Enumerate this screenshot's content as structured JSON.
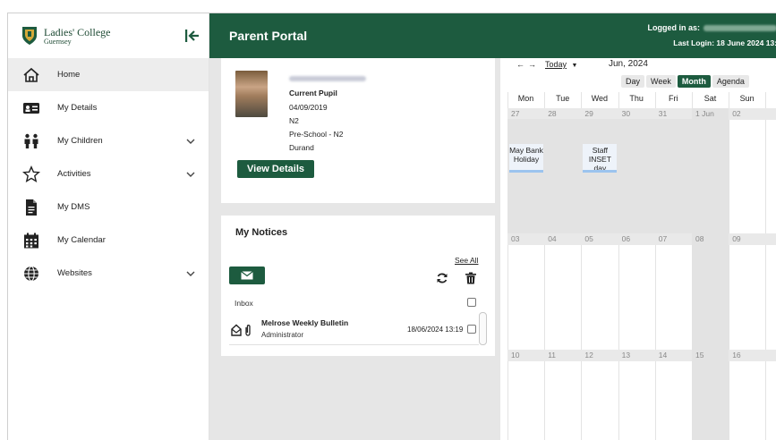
{
  "sidebar": {
    "logo": {
      "line1": "Ladies' College",
      "line2": "Guernsey"
    },
    "items": [
      {
        "label": "Home",
        "icon": "home-icon",
        "active": true
      },
      {
        "label": "My Details",
        "icon": "id-card-icon"
      },
      {
        "label": "My Children",
        "icon": "people-icon",
        "expandable": true
      },
      {
        "label": "Activities",
        "icon": "star-icon",
        "expandable": true
      },
      {
        "label": "My DMS",
        "icon": "document-icon"
      },
      {
        "label": "My Calendar",
        "icon": "calendar-icon"
      },
      {
        "label": "Websites",
        "icon": "globe-icon",
        "expandable": true
      }
    ]
  },
  "header": {
    "title": "Parent Portal",
    "logged_in_label": "Logged in as:",
    "last_login": "Last Login: 18 June 2024 13:"
  },
  "pupil": {
    "status": "Current Pupil",
    "dob": "04/09/2019",
    "year": "N2",
    "class": "Pre-School - N2",
    "house": "Durand",
    "view_button": "View Details"
  },
  "notices": {
    "title": "My Notices",
    "see_all": "See All",
    "folder": "Inbox",
    "messages": [
      {
        "title": "Melrose Weekly Bulletin",
        "from": "Administrator",
        "date": "18/06/2024 13:19"
      }
    ]
  },
  "calendar": {
    "today_label": "Today",
    "month_label": "Jun, 2024",
    "views": [
      "Day",
      "Week",
      "Month",
      "Agenda"
    ],
    "active_view": "Month",
    "weekdays": [
      "Mon",
      "Tue",
      "Wed",
      "Thu",
      "Fri",
      "Sat",
      "Sun"
    ],
    "weeks": [
      [
        "27",
        "28",
        "29",
        "30",
        "31",
        "1 Jun",
        "02"
      ],
      [
        "03",
        "04",
        "05",
        "06",
        "07",
        "08",
        "09"
      ],
      [
        "10",
        "11",
        "12",
        "13",
        "14",
        "15",
        "16"
      ]
    ],
    "events": [
      {
        "text": "May Bank Holiday",
        "day": "Mon"
      },
      {
        "text": "Staff INSET day",
        "day": "Wed"
      }
    ]
  },
  "colors": {
    "brand": "#1d5b3f",
    "event_accent": "#9cc4ee"
  }
}
